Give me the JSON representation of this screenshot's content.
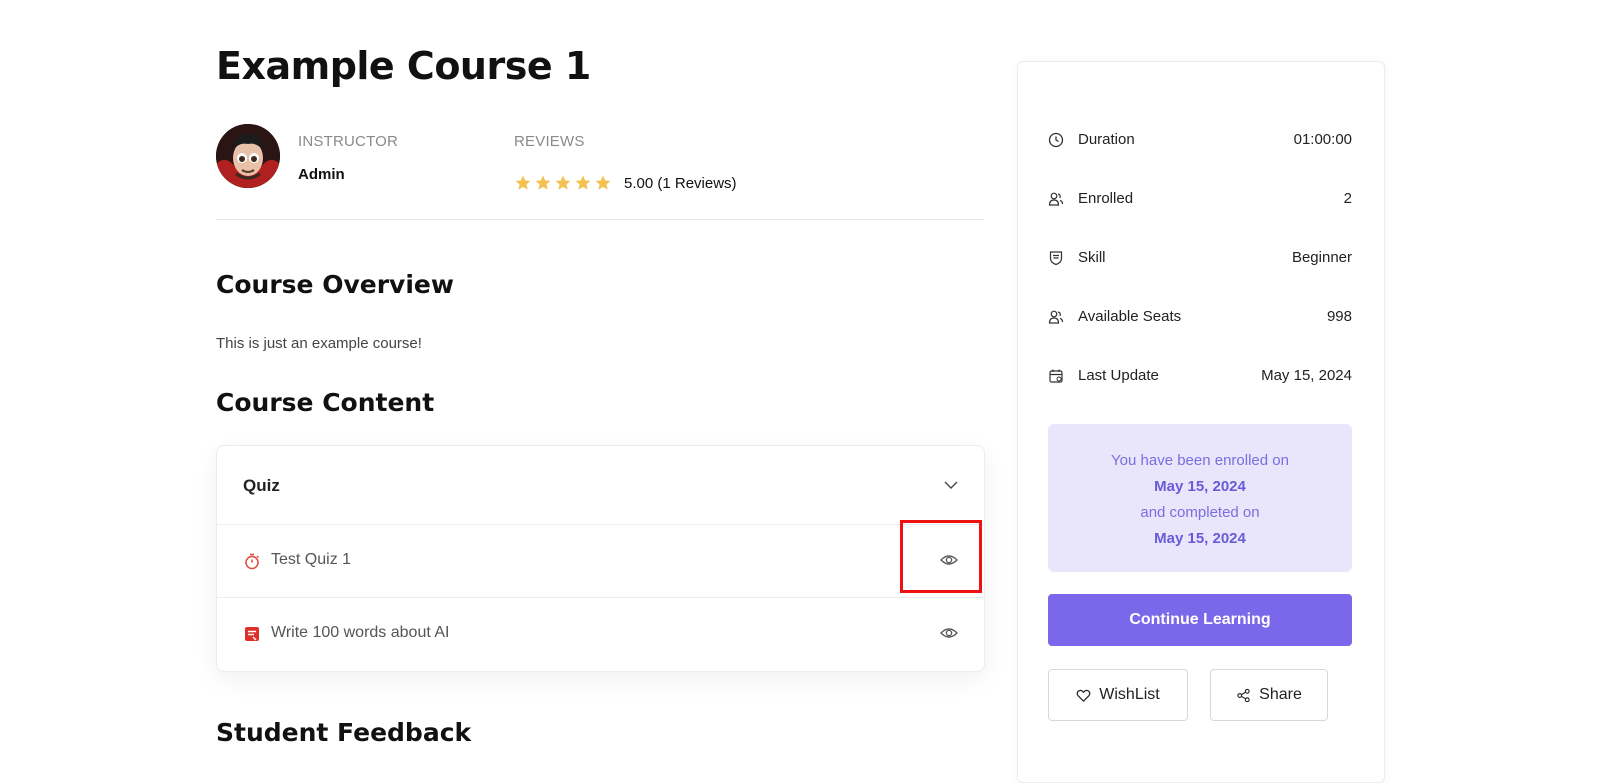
{
  "course": {
    "title": "Example Course 1",
    "instructor_label": "INSTRUCTOR",
    "instructor_name": "Admin",
    "reviews_label": "REVIEWS",
    "rating": 5,
    "rating_text": "5.00 (1 Reviews)"
  },
  "overview": {
    "heading": "Course Overview",
    "text": "This is just an example course!"
  },
  "content": {
    "heading": "Course Content",
    "topic_title": "Quiz",
    "lessons": [
      {
        "label": "Test Quiz 1",
        "icon": "quiz-timer-icon"
      },
      {
        "label": "Write 100 words about AI",
        "icon": "assignment-icon"
      }
    ]
  },
  "feedback": {
    "heading": "Student Feedback"
  },
  "sidebar": {
    "rows": [
      {
        "label": "Duration",
        "value": "01:00:00",
        "icon": "clock-icon"
      },
      {
        "label": "Enrolled",
        "value": "2",
        "icon": "users-icon"
      },
      {
        "label": "Skill",
        "value": "Beginner",
        "icon": "skill-shield-icon"
      },
      {
        "label": "Available Seats",
        "value": "998",
        "icon": "seats-icon"
      },
      {
        "label": "Last Update",
        "value": "May 15, 2024",
        "icon": "calendar-icon"
      }
    ],
    "enrolled_line1": "You have been enrolled on",
    "enrolled_date": "May 15, 2024",
    "completed_line": "and completed on",
    "completed_date": "May 15, 2024",
    "continue_label": "Continue Learning",
    "wishlist_label": "WishList",
    "share_label": "Share"
  },
  "colors": {
    "accent": "#7b67ea",
    "star": "#f4c150",
    "highlight": "#ee1111"
  }
}
